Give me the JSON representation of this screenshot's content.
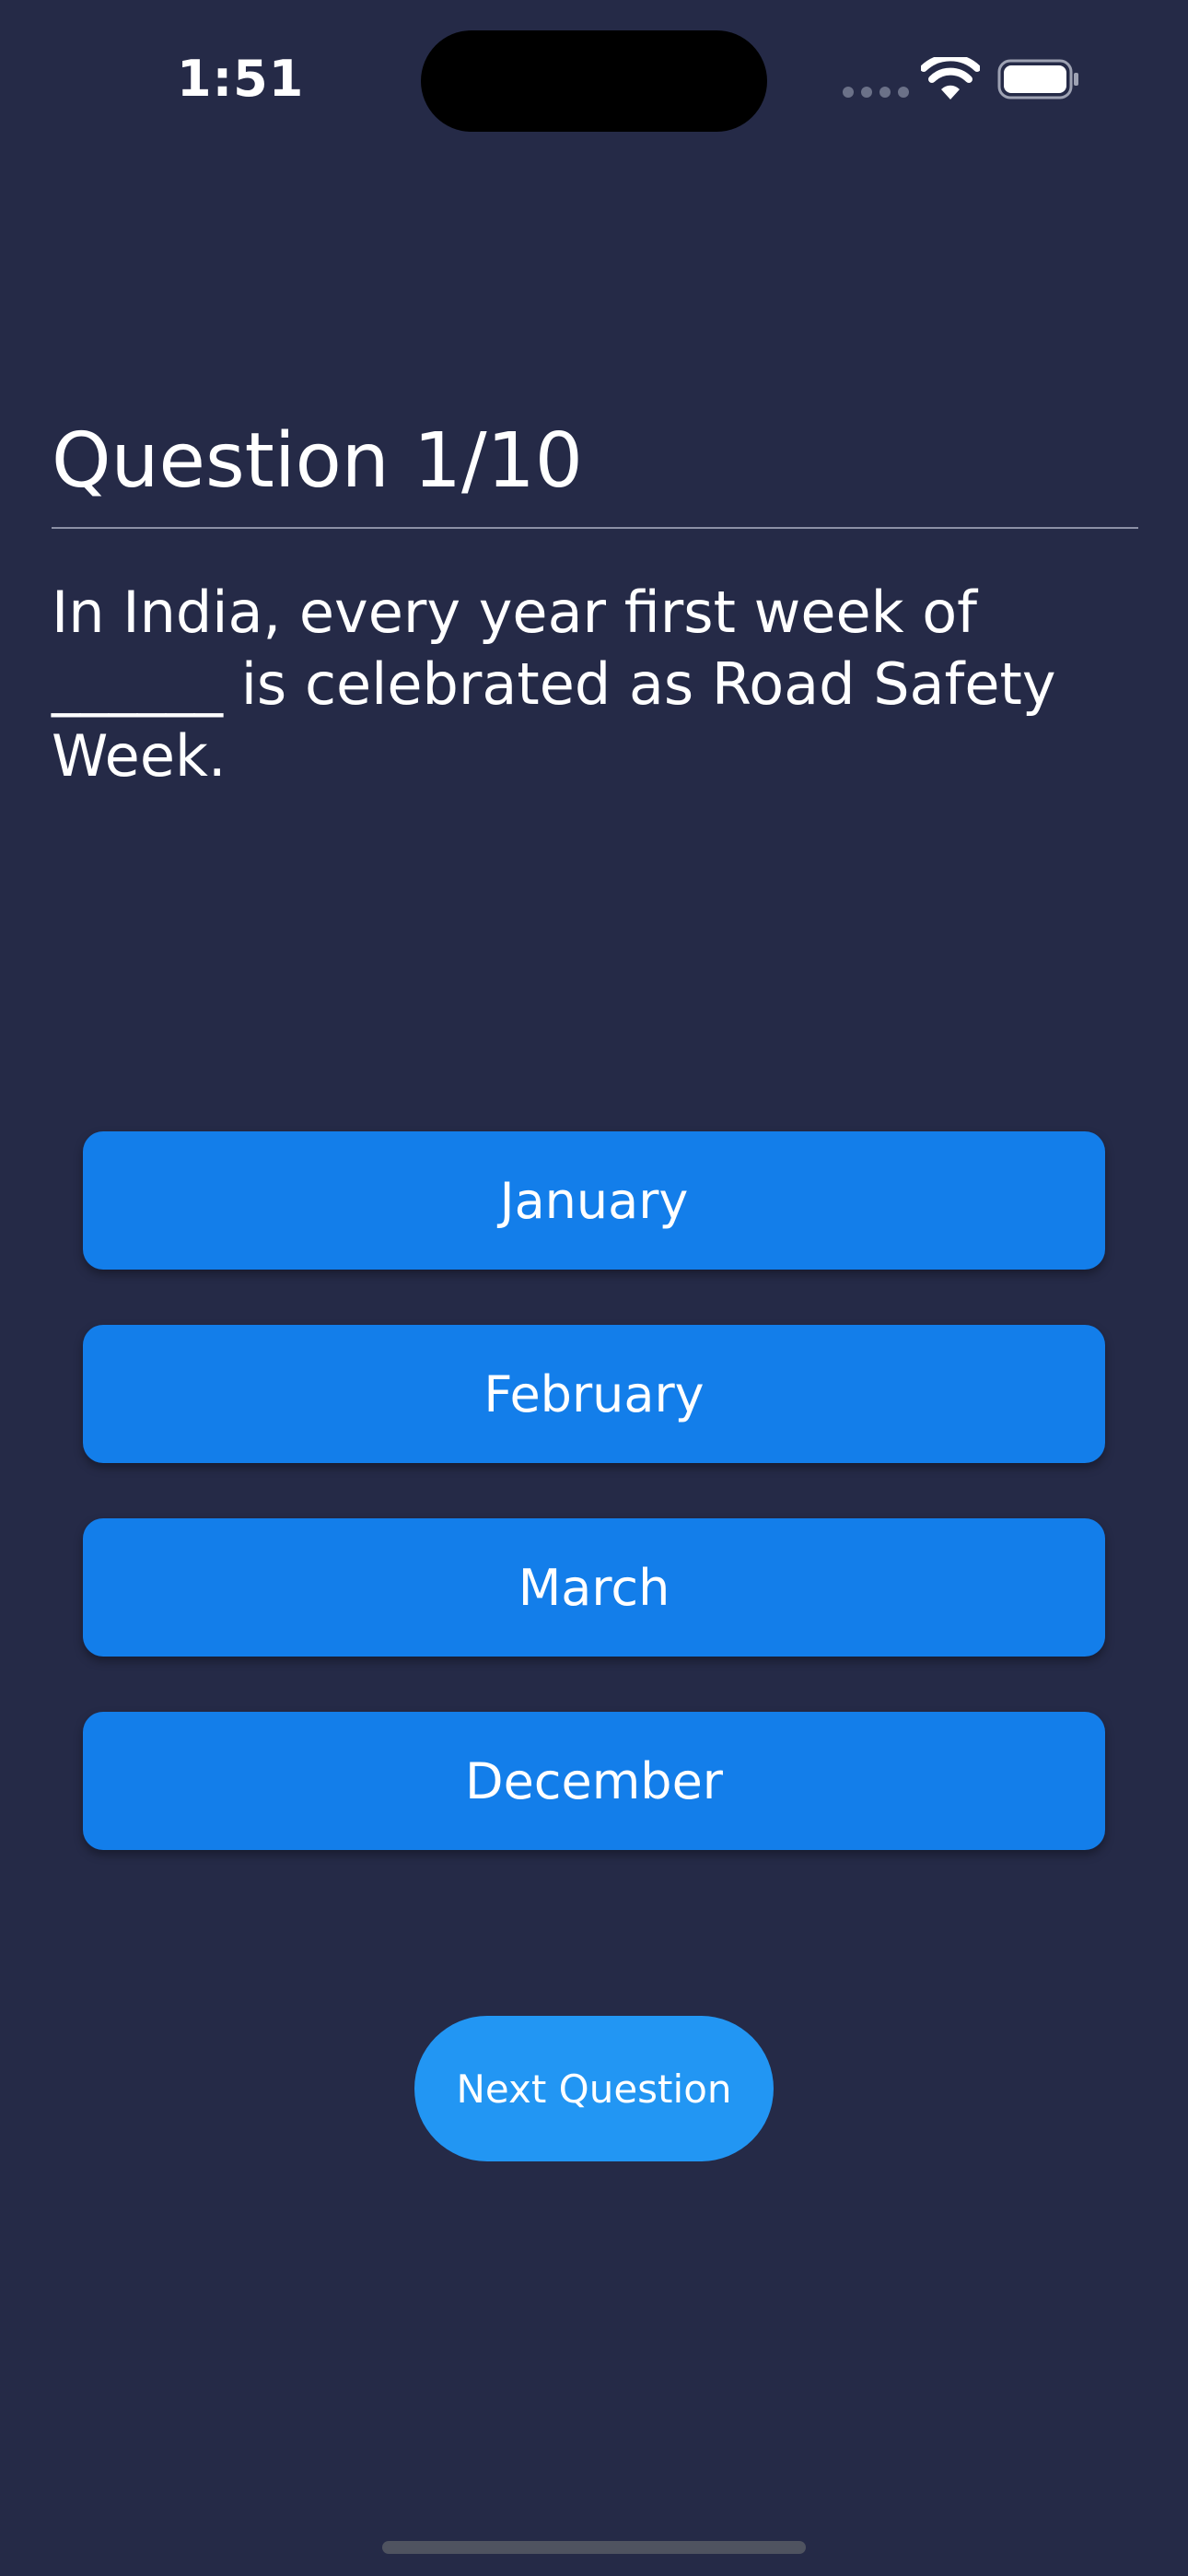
{
  "status_bar": {
    "time": "1:51"
  },
  "quiz": {
    "question_header": "Question 1/10",
    "question_text": "In India, every year first week of ______ is celebrated as Road Safety Week.",
    "answers": [
      {
        "label": "January"
      },
      {
        "label": "February"
      },
      {
        "label": "March"
      },
      {
        "label": "December"
      }
    ],
    "next_label": "Next Question"
  },
  "colors": {
    "background": "#252a47",
    "answer_button": "#137eea",
    "next_button": "#2296f3"
  },
  "icons": [
    "cellular-signal-icon",
    "wifi-icon",
    "battery-icon"
  ]
}
